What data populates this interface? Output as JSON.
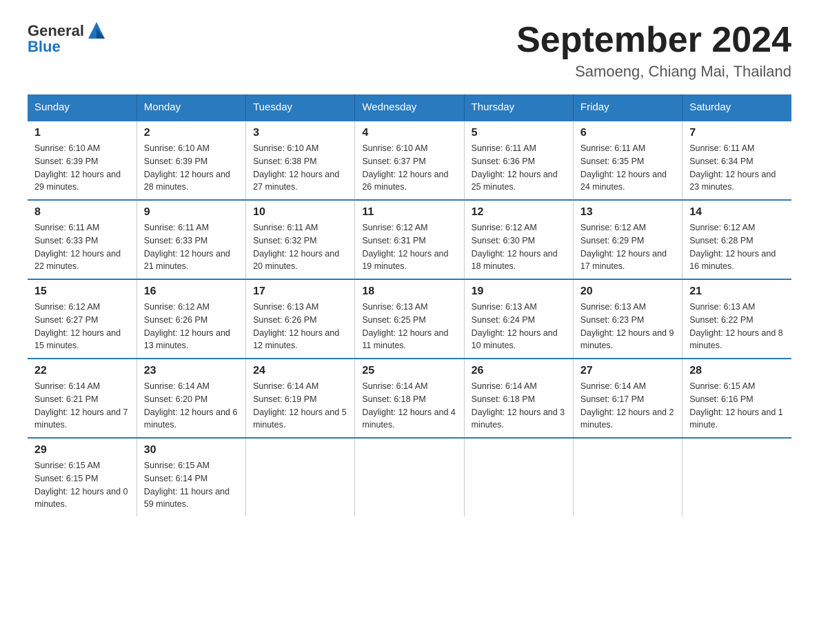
{
  "logo": {
    "text_general": "General",
    "text_blue": "Blue",
    "icon_color": "#1a73c1"
  },
  "title": {
    "month_year": "September 2024",
    "location": "Samoeng, Chiang Mai, Thailand"
  },
  "weekdays": [
    "Sunday",
    "Monday",
    "Tuesday",
    "Wednesday",
    "Thursday",
    "Friday",
    "Saturday"
  ],
  "weeks": [
    [
      {
        "day": "1",
        "sunrise": "Sunrise: 6:10 AM",
        "sunset": "Sunset: 6:39 PM",
        "daylight": "Daylight: 12 hours and 29 minutes."
      },
      {
        "day": "2",
        "sunrise": "Sunrise: 6:10 AM",
        "sunset": "Sunset: 6:39 PM",
        "daylight": "Daylight: 12 hours and 28 minutes."
      },
      {
        "day": "3",
        "sunrise": "Sunrise: 6:10 AM",
        "sunset": "Sunset: 6:38 PM",
        "daylight": "Daylight: 12 hours and 27 minutes."
      },
      {
        "day": "4",
        "sunrise": "Sunrise: 6:10 AM",
        "sunset": "Sunset: 6:37 PM",
        "daylight": "Daylight: 12 hours and 26 minutes."
      },
      {
        "day": "5",
        "sunrise": "Sunrise: 6:11 AM",
        "sunset": "Sunset: 6:36 PM",
        "daylight": "Daylight: 12 hours and 25 minutes."
      },
      {
        "day": "6",
        "sunrise": "Sunrise: 6:11 AM",
        "sunset": "Sunset: 6:35 PM",
        "daylight": "Daylight: 12 hours and 24 minutes."
      },
      {
        "day": "7",
        "sunrise": "Sunrise: 6:11 AM",
        "sunset": "Sunset: 6:34 PM",
        "daylight": "Daylight: 12 hours and 23 minutes."
      }
    ],
    [
      {
        "day": "8",
        "sunrise": "Sunrise: 6:11 AM",
        "sunset": "Sunset: 6:33 PM",
        "daylight": "Daylight: 12 hours and 22 minutes."
      },
      {
        "day": "9",
        "sunrise": "Sunrise: 6:11 AM",
        "sunset": "Sunset: 6:33 PM",
        "daylight": "Daylight: 12 hours and 21 minutes."
      },
      {
        "day": "10",
        "sunrise": "Sunrise: 6:11 AM",
        "sunset": "Sunset: 6:32 PM",
        "daylight": "Daylight: 12 hours and 20 minutes."
      },
      {
        "day": "11",
        "sunrise": "Sunrise: 6:12 AM",
        "sunset": "Sunset: 6:31 PM",
        "daylight": "Daylight: 12 hours and 19 minutes."
      },
      {
        "day": "12",
        "sunrise": "Sunrise: 6:12 AM",
        "sunset": "Sunset: 6:30 PM",
        "daylight": "Daylight: 12 hours and 18 minutes."
      },
      {
        "day": "13",
        "sunrise": "Sunrise: 6:12 AM",
        "sunset": "Sunset: 6:29 PM",
        "daylight": "Daylight: 12 hours and 17 minutes."
      },
      {
        "day": "14",
        "sunrise": "Sunrise: 6:12 AM",
        "sunset": "Sunset: 6:28 PM",
        "daylight": "Daylight: 12 hours and 16 minutes."
      }
    ],
    [
      {
        "day": "15",
        "sunrise": "Sunrise: 6:12 AM",
        "sunset": "Sunset: 6:27 PM",
        "daylight": "Daylight: 12 hours and 15 minutes."
      },
      {
        "day": "16",
        "sunrise": "Sunrise: 6:12 AM",
        "sunset": "Sunset: 6:26 PM",
        "daylight": "Daylight: 12 hours and 13 minutes."
      },
      {
        "day": "17",
        "sunrise": "Sunrise: 6:13 AM",
        "sunset": "Sunset: 6:26 PM",
        "daylight": "Daylight: 12 hours and 12 minutes."
      },
      {
        "day": "18",
        "sunrise": "Sunrise: 6:13 AM",
        "sunset": "Sunset: 6:25 PM",
        "daylight": "Daylight: 12 hours and 11 minutes."
      },
      {
        "day": "19",
        "sunrise": "Sunrise: 6:13 AM",
        "sunset": "Sunset: 6:24 PM",
        "daylight": "Daylight: 12 hours and 10 minutes."
      },
      {
        "day": "20",
        "sunrise": "Sunrise: 6:13 AM",
        "sunset": "Sunset: 6:23 PM",
        "daylight": "Daylight: 12 hours and 9 minutes."
      },
      {
        "day": "21",
        "sunrise": "Sunrise: 6:13 AM",
        "sunset": "Sunset: 6:22 PM",
        "daylight": "Daylight: 12 hours and 8 minutes."
      }
    ],
    [
      {
        "day": "22",
        "sunrise": "Sunrise: 6:14 AM",
        "sunset": "Sunset: 6:21 PM",
        "daylight": "Daylight: 12 hours and 7 minutes."
      },
      {
        "day": "23",
        "sunrise": "Sunrise: 6:14 AM",
        "sunset": "Sunset: 6:20 PM",
        "daylight": "Daylight: 12 hours and 6 minutes."
      },
      {
        "day": "24",
        "sunrise": "Sunrise: 6:14 AM",
        "sunset": "Sunset: 6:19 PM",
        "daylight": "Daylight: 12 hours and 5 minutes."
      },
      {
        "day": "25",
        "sunrise": "Sunrise: 6:14 AM",
        "sunset": "Sunset: 6:18 PM",
        "daylight": "Daylight: 12 hours and 4 minutes."
      },
      {
        "day": "26",
        "sunrise": "Sunrise: 6:14 AM",
        "sunset": "Sunset: 6:18 PM",
        "daylight": "Daylight: 12 hours and 3 minutes."
      },
      {
        "day": "27",
        "sunrise": "Sunrise: 6:14 AM",
        "sunset": "Sunset: 6:17 PM",
        "daylight": "Daylight: 12 hours and 2 minutes."
      },
      {
        "day": "28",
        "sunrise": "Sunrise: 6:15 AM",
        "sunset": "Sunset: 6:16 PM",
        "daylight": "Daylight: 12 hours and 1 minute."
      }
    ],
    [
      {
        "day": "29",
        "sunrise": "Sunrise: 6:15 AM",
        "sunset": "Sunset: 6:15 PM",
        "daylight": "Daylight: 12 hours and 0 minutes."
      },
      {
        "day": "30",
        "sunrise": "Sunrise: 6:15 AM",
        "sunset": "Sunset: 6:14 PM",
        "daylight": "Daylight: 11 hours and 59 minutes."
      },
      null,
      null,
      null,
      null,
      null
    ]
  ]
}
